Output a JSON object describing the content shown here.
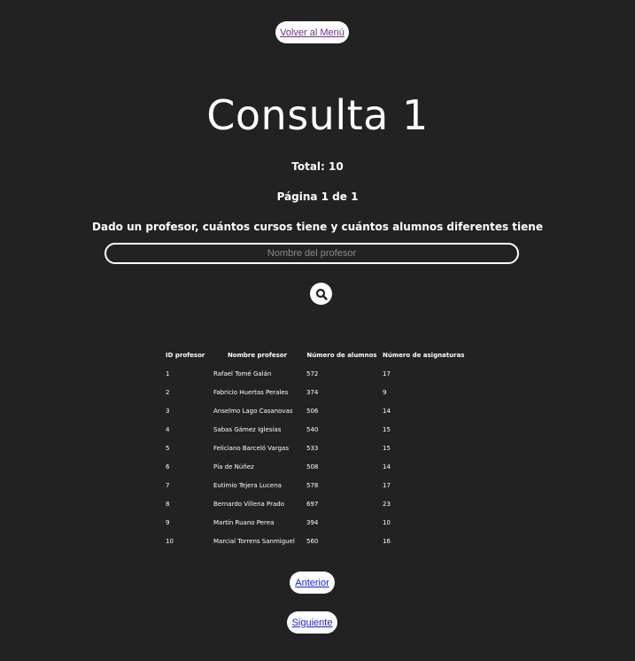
{
  "nav": {
    "back_label": "Volver al Menú"
  },
  "header": {
    "title": "Consulta 1",
    "total": "Total: 10",
    "page": "Página 1 de 1",
    "description": "Dado un profesor, cuántos cursos tiene y cuántos alumnos diferentes tiene"
  },
  "search": {
    "placeholder": "Nombre del profesor",
    "value": "",
    "button_icon": "search-icon"
  },
  "table": {
    "headers": [
      "ID profesor",
      "Nombre profesor",
      "Número de alumnos",
      "Número de asignaturas"
    ],
    "rows": [
      [
        "1",
        "Rafael Tomé Galán",
        "572",
        "17"
      ],
      [
        "2",
        "Fabricio Huertas Perales",
        "374",
        "9"
      ],
      [
        "3",
        "Anselmo Lago Casanovas",
        "506",
        "14"
      ],
      [
        "4",
        "Sabas Gámez Iglesias",
        "540",
        "15"
      ],
      [
        "5",
        "Feliciano Barceló Vargas",
        "533",
        "15"
      ],
      [
        "6",
        "Pía de Núñez",
        "508",
        "14"
      ],
      [
        "7",
        "Eutimio Tejera Lucena",
        "578",
        "17"
      ],
      [
        "8",
        "Bernardo Villena Prado",
        "697",
        "23"
      ],
      [
        "9",
        "Martín Ruano Perea",
        "394",
        "10"
      ],
      [
        "10",
        "Marcial Torrens Sanmiguel",
        "560",
        "16"
      ]
    ]
  },
  "pagination": {
    "prev_label": "Anterior",
    "next_label": "Siguiente"
  },
  "colors": {
    "background": "#222222",
    "visited_link": "#6b2f8c",
    "link": "#1a1adc"
  }
}
